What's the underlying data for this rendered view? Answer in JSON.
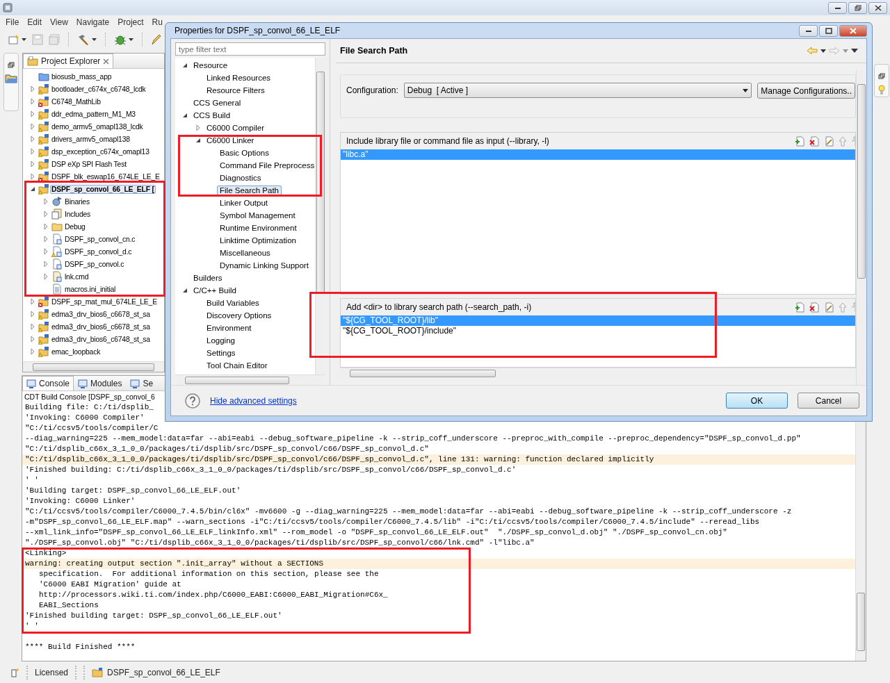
{
  "menu": [
    {
      "label": "File"
    },
    {
      "label": "Edit"
    },
    {
      "label": "View"
    },
    {
      "label": "Navigate"
    },
    {
      "label": "Project"
    },
    {
      "label": "Ru"
    }
  ],
  "project_explorer": {
    "title": "Project Explorer",
    "items": [
      {
        "label": "biosusb_mass_app",
        "kind": "folder",
        "warning": false,
        "error": false,
        "selected": false
      },
      {
        "label": "bootloader_c674x_c6748_lcdk",
        "kind": "project",
        "warning": true,
        "error": false,
        "expanded": false,
        "selected": false
      },
      {
        "label": "C6748_MathLib",
        "kind": "project",
        "warning": false,
        "error": true,
        "expanded": false,
        "selected": false
      },
      {
        "label": "ddr_edma_pattern_M1_M3",
        "kind": "project",
        "warning": true,
        "error": false,
        "expanded": false,
        "selected": false
      },
      {
        "label": "demo_armv5_omapl138_lcdk",
        "kind": "project",
        "warning": true,
        "error": false,
        "expanded": false,
        "selected": false
      },
      {
        "label": "drivers_armv5_omapl138",
        "kind": "project",
        "warning": true,
        "error": false,
        "expanded": false,
        "selected": false
      },
      {
        "label": "dsp_exception_c674x_omapl13",
        "kind": "project",
        "warning": true,
        "error": false,
        "expanded": false,
        "selected": false
      },
      {
        "label": "DSP eXp SPI Flash Test",
        "kind": "project",
        "warning": true,
        "error": false,
        "expanded": false,
        "selected": false
      },
      {
        "label": "DSPF_blk_eswap16_674LE_LE_E",
        "kind": "project",
        "warning": false,
        "error": true,
        "expanded": false,
        "selected": false
      },
      {
        "label": "DSPF_sp_convol_66_LE_ELF [",
        "kind": "project",
        "warning": true,
        "error": false,
        "expanded": true,
        "selected": true,
        "children": [
          {
            "label": "Binaries",
            "kind": "binaries",
            "warning": false,
            "error": false,
            "expanded": false,
            "selected": false
          },
          {
            "label": "Includes",
            "kind": "includes",
            "warning": false,
            "error": false,
            "expanded": false,
            "selected": false
          },
          {
            "label": "Debug",
            "kind": "debug-folder",
            "warning": false,
            "error": false,
            "expanded": false,
            "selected": false
          },
          {
            "label": "DSPF_sp_convol_cn.c",
            "kind": "source",
            "warning": false,
            "error": false,
            "expanded": false,
            "selected": false
          },
          {
            "label": "DSPF_sp_convol_d.c",
            "kind": "source",
            "warning": true,
            "error": false,
            "expanded": false,
            "selected": false
          },
          {
            "label": "DSPF_sp_convol.c",
            "kind": "source",
            "warning": false,
            "error": false,
            "expanded": false,
            "selected": false
          },
          {
            "label": "lnk.cmd",
            "kind": "cmd",
            "warning": false,
            "error": false,
            "expanded": false,
            "selected": false
          },
          {
            "label": "macros.ini_initial",
            "kind": "text",
            "warning": false,
            "error": false,
            "selected": false
          }
        ]
      },
      {
        "label": "DSPF_sp_mat_mul_674LE_LE_E",
        "kind": "project",
        "warning": false,
        "error": true,
        "expanded": false,
        "selected": false
      },
      {
        "label": "edma3_drv_bios6_c6678_st_sa",
        "kind": "project",
        "warning": true,
        "error": false,
        "expanded": false,
        "selected": false
      },
      {
        "label": "edma3_drv_bios6_c6678_st_sa",
        "kind": "project",
        "warning": true,
        "error": false,
        "expanded": false,
        "selected": false
      },
      {
        "label": "edma3_drv_bios6_c6748_st_sa",
        "kind": "project",
        "warning": true,
        "error": false,
        "expanded": false,
        "selected": false
      },
      {
        "label": "emac_loopback",
        "kind": "project",
        "warning": true,
        "error": false,
        "expanded": false,
        "selected": false
      }
    ]
  },
  "console": {
    "tabs": [
      {
        "label": "Console",
        "selected": true
      },
      {
        "label": "Modules",
        "selected": false
      },
      {
        "label": "Se",
        "selected": false
      }
    ],
    "title": "CDT Build Console [DSPF_sp_convol_6",
    "lines": [
      {
        "text": "Building file: C:/ti/dsplib_",
        "kind": "plain"
      },
      {
        "text": "'Invoking: C6000 Compiler'",
        "kind": "plain"
      },
      {
        "text": "\"C:/ti/ccsv5/tools/compiler/C",
        "kind": "plain"
      },
      {
        "text": "--diag_warning=225 --mem_model:data=far --abi=eabi --debug_software_pipeline -k --strip_coff_underscore --preproc_with_compile --preproc_dependency=\"DSPF_sp_convol_d.pp\"",
        "kind": "plain"
      },
      {
        "text": "\"C:/ti/dsplib_c66x_3_1_0_0/packages/ti/dsplib/src/DSPF_sp_convol/c66/DSPF_sp_convol_d.c\"",
        "kind": "plain"
      },
      {
        "text": "\"C:/ti/dsplib_c66x_3_1_0_0/packages/ti/dsplib/src/DSPF_sp_convol/c66/DSPF_sp_convol_d.c\", line 131: warning: function declared implicitly",
        "kind": "warning"
      },
      {
        "text": "'Finished building: C:/ti/dsplib_c66x_3_1_0_0/packages/ti/dsplib/src/DSPF_sp_convol/c66/DSPF_sp_convol_d.c'",
        "kind": "plain"
      },
      {
        "text": "' '",
        "kind": "plain"
      },
      {
        "text": "'Building target: DSPF_sp_convol_66_LE_ELF.out'",
        "kind": "plain"
      },
      {
        "text": "'Invoking: C6000 Linker'",
        "kind": "plain"
      },
      {
        "text": "\"C:/ti/ccsv5/tools/compiler/C6000_7.4.5/bin/cl6x\" -mv6600 -g --diag_warning=225 --mem_model:data=far --abi=eabi --debug_software_pipeline -k --strip_coff_underscore -z",
        "kind": "plain"
      },
      {
        "text": "-m\"DSPF_sp_convol_66_LE_ELF.map\" --warn_sections -i\"C:/ti/ccsv5/tools/compiler/C6000_7.4.5/lib\" -i\"C:/ti/ccsv5/tools/compiler/C6000_7.4.5/include\" --reread_libs",
        "kind": "plain"
      },
      {
        "text": "--xml_link_info=\"DSPF_sp_convol_66_LE_ELF_linkInfo.xml\" --rom_model -o \"DSPF_sp_convol_66_LE_ELF.out\"  \"./DSPF_sp_convol_d.obj\" \"./DSPF_sp_convol_cn.obj\"",
        "kind": "plain"
      },
      {
        "text": "\"./DSPF_sp_convol.obj\" \"C:/ti/dsplib_c66x_3_1_0_0/packages/ti/dsplib/src/DSPF_sp_convol/c66/lnk.cmd\" -l\"libc.a\"",
        "kind": "plain"
      },
      {
        "text": "<Linking>",
        "kind": "plain"
      },
      {
        "text": "warning: creating output section \".init_array\" without a SECTIONS",
        "kind": "warning"
      },
      {
        "text": "specification.  For additional information on this section, please see the",
        "kind": "continuation"
      },
      {
        "text": "'C6000 EABI Migration' guide at",
        "kind": "continuation"
      },
      {
        "text": "http://processors.wiki.ti.com/index.php/C6000_EABI:C6000_EABI_Migration#C6x_",
        "kind": "continuation"
      },
      {
        "text": "EABI_Sections",
        "kind": "continuation"
      },
      {
        "text": "'Finished building target: DSPF_sp_convol_66_LE_ELF.out'",
        "kind": "plain"
      },
      {
        "text": "' '",
        "kind": "plain"
      }
    ],
    "footer": "**** Build Finished ****"
  },
  "status_bar": {
    "license": "Licensed",
    "project": "DSPF_sp_convol_66_LE_ELF"
  },
  "dialog": {
    "title": "Properties for DSPF_sp_convol_66_LE_ELF",
    "filter": {
      "placeholder": "type filter text"
    },
    "tree": [
      {
        "label": "Resource",
        "expanded": true,
        "selected": false,
        "children": [
          {
            "label": "Linked Resources",
            "selected": false
          },
          {
            "label": "Resource Filters",
            "selected": false
          }
        ]
      },
      {
        "label": "CCS General",
        "selected": false
      },
      {
        "label": "CCS Build",
        "expanded": true,
        "selected": false,
        "children": [
          {
            "label": "C6000 Compiler",
            "expanded": false,
            "selected": false
          },
          {
            "label": "C6000 Linker",
            "expanded": true,
            "selected": false,
            "children": [
              {
                "label": "Basic Options",
                "selected": false
              },
              {
                "label": "Command File Preprocess",
                "selected": false
              },
              {
                "label": "Diagnostics",
                "selected": false
              },
              {
                "label": "File Search Path",
                "selected": true
              },
              {
                "label": "Linker Output",
                "selected": false
              },
              {
                "label": "Symbol Management",
                "selected": false
              },
              {
                "label": "Runtime Environment",
                "selected": false
              },
              {
                "label": "Linktime Optimization",
                "selected": false
              },
              {
                "label": "Miscellaneous",
                "selected": false
              },
              {
                "label": "Dynamic Linking Support",
                "selected": false
              }
            ]
          }
        ]
      },
      {
        "label": "Builders",
        "selected": false
      },
      {
        "label": "C/C++ Build",
        "expanded": true,
        "selected": false,
        "children": [
          {
            "label": "Build Variables",
            "selected": false
          },
          {
            "label": "Discovery Options",
            "selected": false
          },
          {
            "label": "Environment",
            "selected": false
          },
          {
            "label": "Logging",
            "selected": false
          },
          {
            "label": "Settings",
            "selected": false
          },
          {
            "label": "Tool Chain Editor",
            "selected": false
          }
        ]
      }
    ],
    "page": {
      "title": "File Search Path",
      "configuration": {
        "label": "Configuration:",
        "value": "Debug  [ Active ]",
        "button": "Manage Configurations.."
      },
      "lists": [
        {
          "title": "Include library file or command file as input (--library, -l)",
          "rows": [
            {
              "text": "\"libc.a\"",
              "selected": true
            }
          ]
        },
        {
          "title": "Add <dir> to library search path (--search_path, -i)",
          "rows": [
            {
              "text": "\"${CG_TOOL_ROOT}/lib\"",
              "selected": true
            },
            {
              "text": "\"${CG_TOOL_ROOT}/include\"",
              "selected": false
            }
          ]
        }
      ]
    },
    "link": "Hide advanced settings",
    "buttons": [
      {
        "label": "OK",
        "default": true
      },
      {
        "label": "Cancel",
        "default": false
      }
    ]
  }
}
